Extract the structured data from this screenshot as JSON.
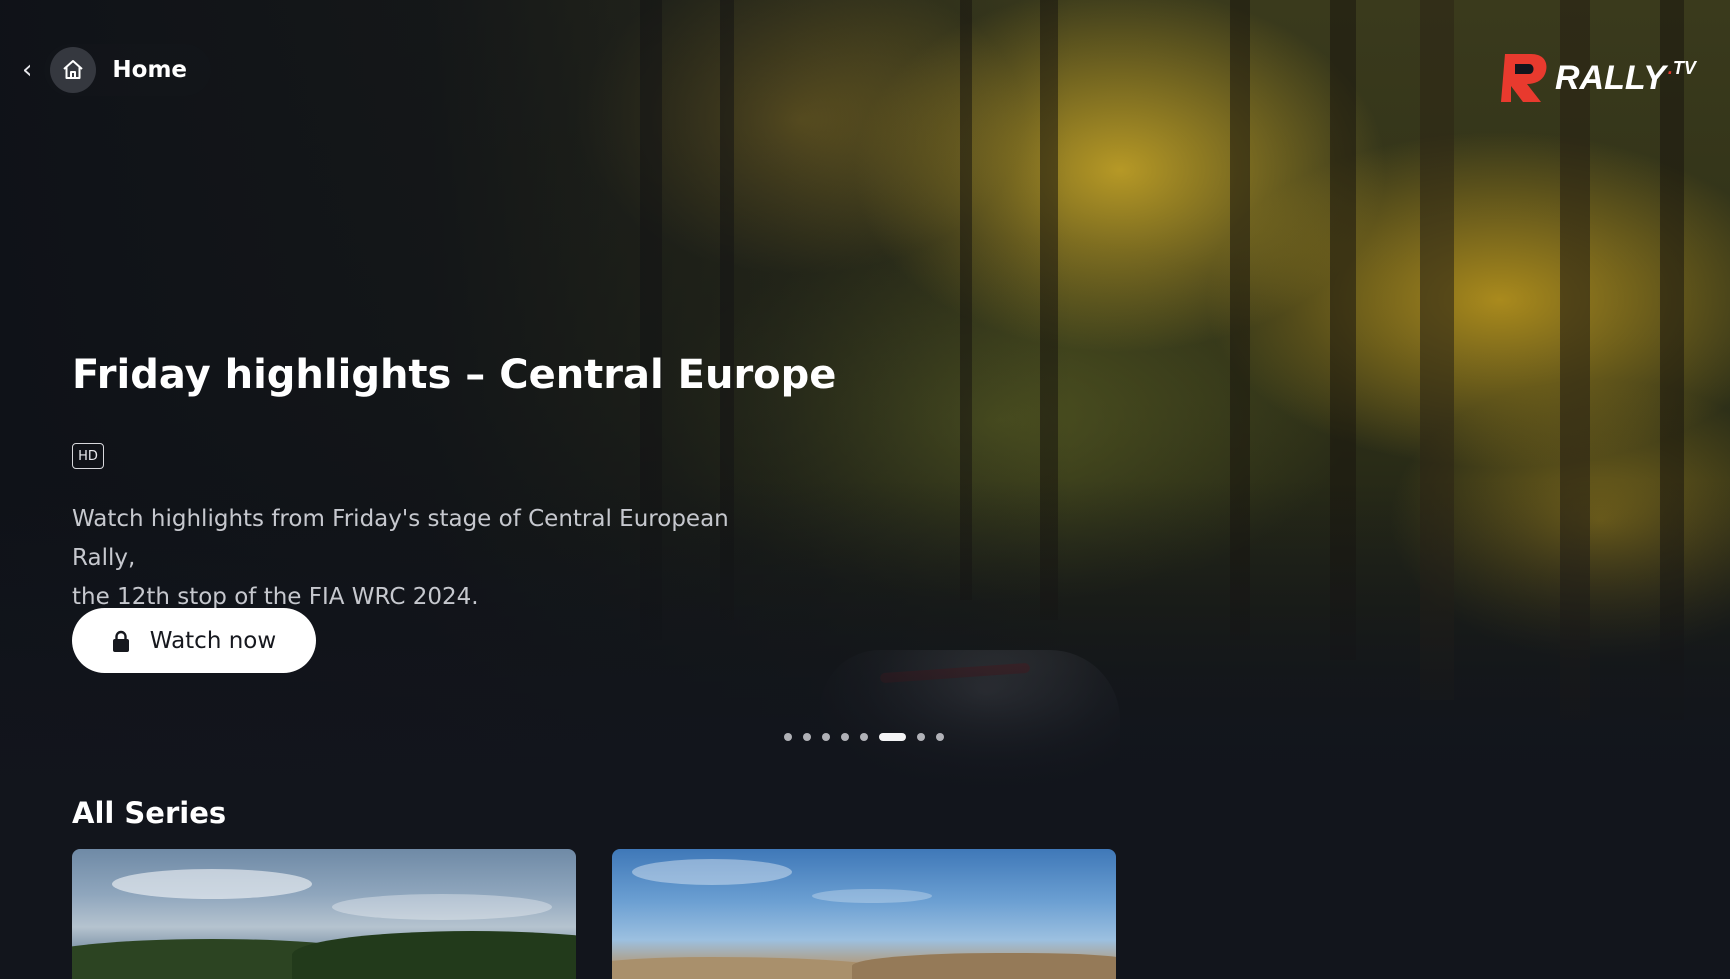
{
  "nav": {
    "back_icon": "chevron-left-icon",
    "home_icon": "home-icon",
    "home_label": "Home"
  },
  "brand": {
    "logo_text": "RALLY",
    "logo_suffix": "TV",
    "accent_color": "#e83a2e"
  },
  "hero": {
    "title": "Friday highlights – Central Europe",
    "quality_badge": "HD",
    "description_line1": "Watch highlights from Friday's stage of Central European Rally,",
    "description_line2": "the 12th stop of the FIA WRC 2024.",
    "cta_label": "Watch now",
    "cta_icon": "lock-icon"
  },
  "carousel": {
    "total_slides": 8,
    "active_index": 5
  },
  "series": {
    "title": "All Series",
    "cards": [
      {
        "image": "landscape-forest-hills"
      },
      {
        "image": "landscape-desert-hills"
      }
    ]
  },
  "colors": {
    "background": "#12151c",
    "button_bg": "#ffffff",
    "button_text": "#16181e",
    "text_muted": "#c6c8ce"
  }
}
